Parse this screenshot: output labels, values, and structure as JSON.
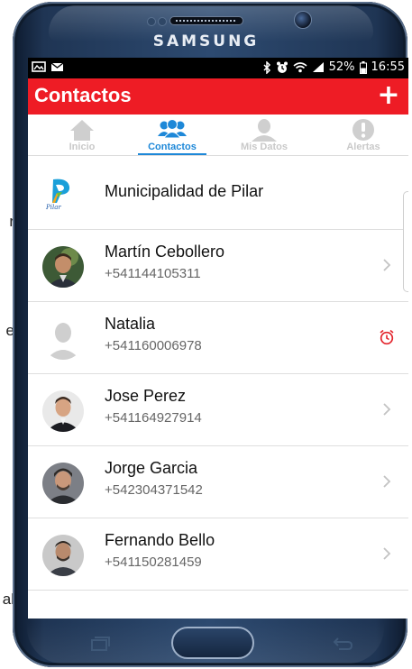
{
  "side_fragments": [
    "r",
    "e",
    "al"
  ],
  "device": {
    "brand": "SAMSUNG"
  },
  "statusbar": {
    "battery": "52%",
    "time": "16:55"
  },
  "appbar": {
    "title": "Contactos",
    "add_label": "+"
  },
  "tabs": [
    {
      "label": "Inicio",
      "icon": "home-icon",
      "active": false
    },
    {
      "label": "Contactos",
      "icon": "contacts-icon",
      "active": true
    },
    {
      "label": "Mis Datos",
      "icon": "person-icon",
      "active": false
    },
    {
      "label": "Alertas",
      "icon": "alert-icon",
      "active": false
    }
  ],
  "contacts": [
    {
      "name": "Municipalidad de Pilar",
      "phone": "",
      "avatar": "pilar-logo",
      "action": "none"
    },
    {
      "name": "Martín Cebollero",
      "phone": "+541144105311",
      "avatar": "photo",
      "action": "chevron"
    },
    {
      "name": "Natalia",
      "phone": "+541160006978",
      "avatar": "placeholder",
      "action": "clock"
    },
    {
      "name": "Jose Perez",
      "phone": "+541164927914",
      "avatar": "photo",
      "action": "chevron"
    },
    {
      "name": "Jorge Garcia",
      "phone": "+542304371542",
      "avatar": "photo",
      "action": "chevron"
    },
    {
      "name": "Fernando Bello",
      "phone": "+541150281459",
      "avatar": "photo",
      "action": "chevron"
    }
  ],
  "logo_text": "Pilar",
  "colors": {
    "accent": "#ee1c25",
    "tab_active": "#1e88d8",
    "tab_inactive": "#c9c9c9",
    "clock_alert": "#e3232b"
  }
}
